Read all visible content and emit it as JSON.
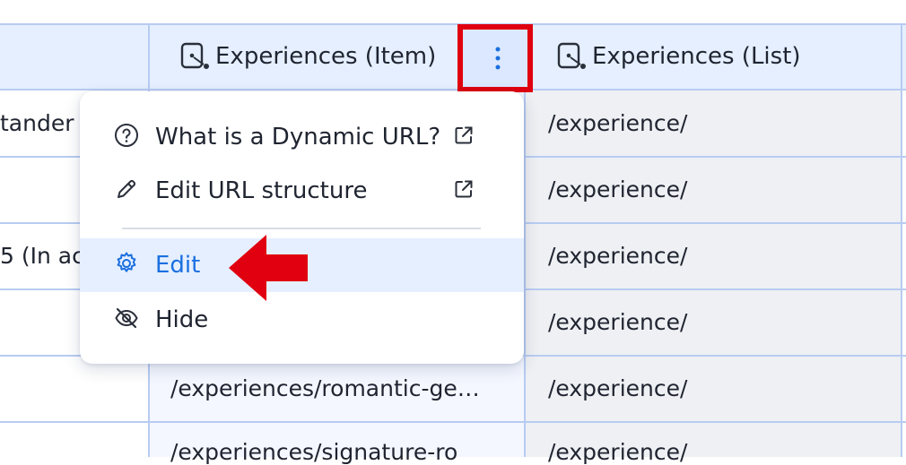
{
  "table": {
    "columns": [
      {
        "label": ""
      },
      {
        "label": "Experiences (Item)"
      },
      {
        "label": "Experiences (List)"
      }
    ],
    "first_col_fragments": [
      "tander",
      "",
      "5 (In ac",
      "",
      "",
      ""
    ],
    "item_col_values": [
      "",
      "",
      "",
      "",
      "/experiences/romantic-ge…",
      "/experiences/signature-ro"
    ],
    "list_col_values": [
      "/experience/",
      "/experience/",
      "/experience/",
      "/experience/",
      "/experience/",
      "/experience/"
    ]
  },
  "menu": {
    "items": [
      {
        "label": "What is a Dynamic URL?",
        "icon": "help-circle-icon",
        "external": true
      },
      {
        "label": "Edit URL structure",
        "icon": "pencil-icon",
        "external": true
      },
      {
        "label": "Edit",
        "icon": "gear-icon",
        "external": false,
        "active": true
      },
      {
        "label": "Hide",
        "icon": "eye-off-icon",
        "external": false
      }
    ]
  },
  "colors": {
    "header_bg": "#e5efff",
    "grid_line": "#b8ccf2",
    "accent": "#1a6fe0",
    "highlight_red": "#e0000f"
  }
}
